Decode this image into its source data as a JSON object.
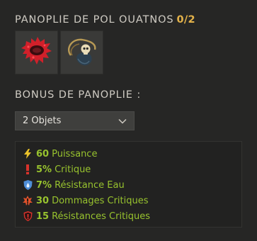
{
  "set": {
    "title": "PANOPLIE DE POL OUATNOS",
    "count": "0/2",
    "items": [
      {
        "icon": "red-spiky-ring-icon"
      },
      {
        "icon": "skull-amulet-icon"
      }
    ]
  },
  "bonus": {
    "title": "BONUS DE PANOPLIE :",
    "selected": "2 Objets",
    "effects": [
      {
        "value": "60",
        "label": "Puissance",
        "icon": "lightning-icon",
        "color": "#e9c12a"
      },
      {
        "value": "5%",
        "label": "Critique",
        "icon": "exclamation-icon",
        "color": "#d8322b"
      },
      {
        "value": "7%",
        "label": "Résistance Eau",
        "icon": "water-shield-icon",
        "color": "#4f8ed8"
      },
      {
        "value": "30",
        "label": "Dommages Critiques",
        "icon": "critical-damage-icon",
        "color": "#e0522c"
      },
      {
        "value": "15",
        "label": "Résistances Critiques",
        "icon": "critical-shield-icon",
        "color": "#d8322b"
      }
    ]
  },
  "colors": {
    "accent": "#e3b24a",
    "bonus_text": "#98c32e",
    "background": "#262625"
  }
}
